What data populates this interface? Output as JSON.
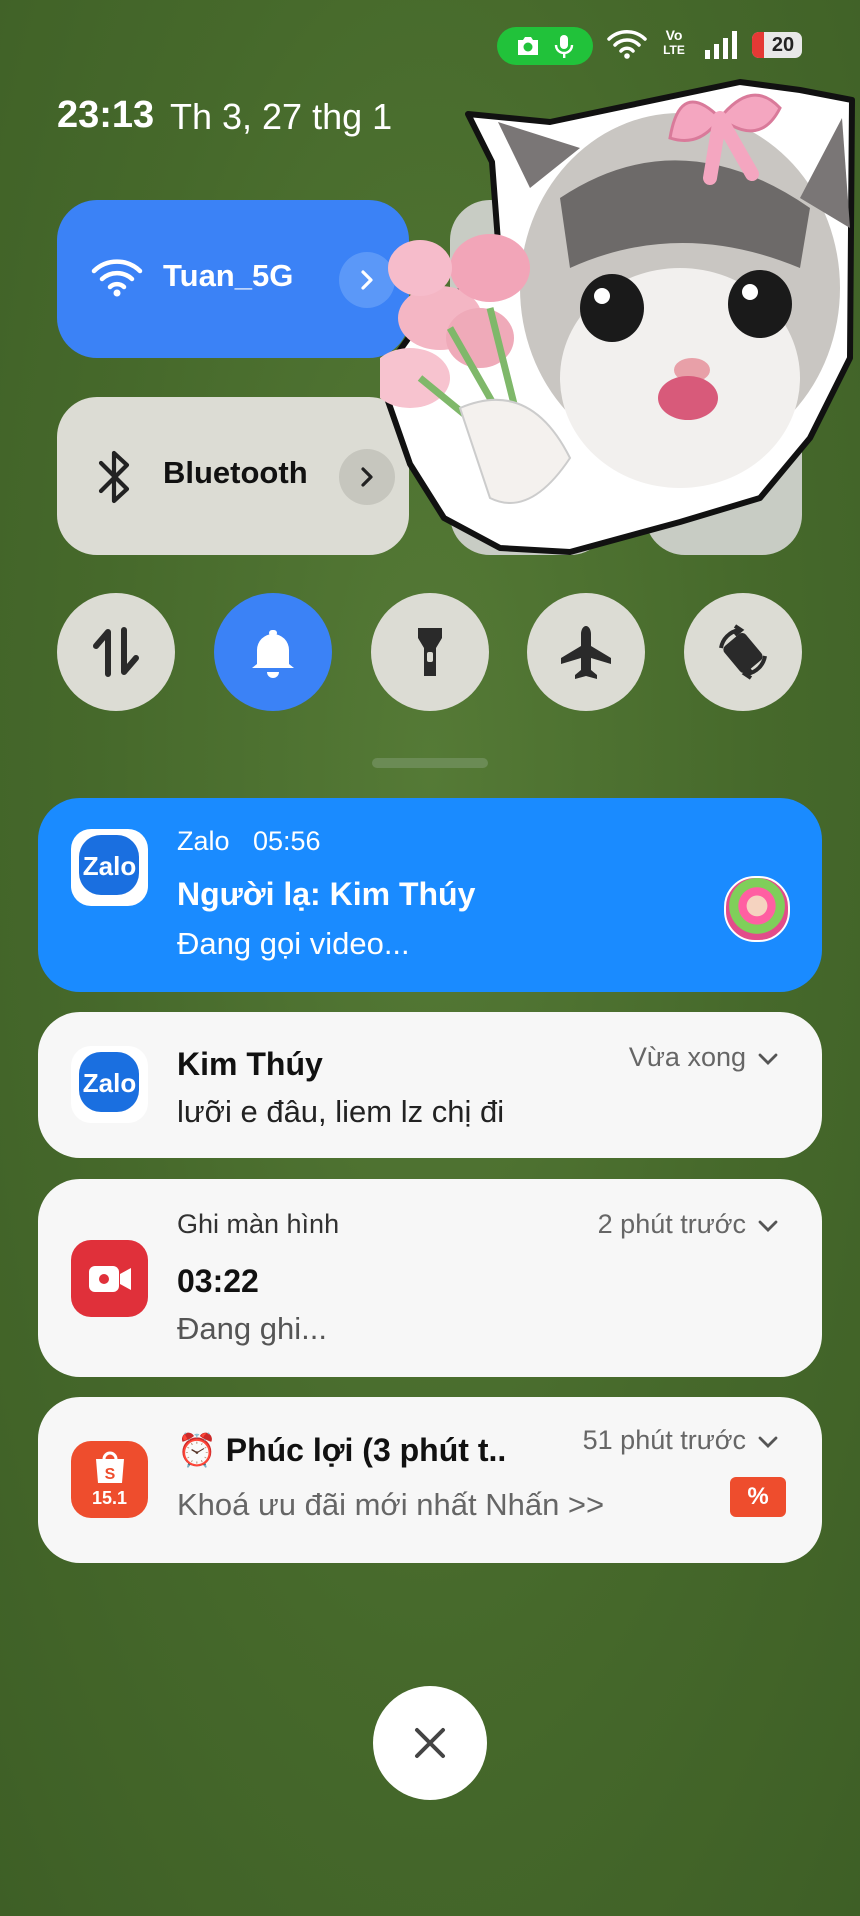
{
  "status_bar": {
    "battery": "20",
    "battery_level_percent": 20,
    "icons": [
      "camera-icon",
      "mic-icon",
      "wifi-icon",
      "volte-icon",
      "signal-icon",
      "battery-icon"
    ],
    "volte_top": "Vo",
    "volte_bottom": "LTE"
  },
  "header": {
    "time": "23:13",
    "date": "Th 3, 27 thg 1"
  },
  "quick_settings": {
    "wifi": {
      "label": "Tuan_5G",
      "icon": "wifi-icon",
      "active": true
    },
    "bluetooth": {
      "label": "Bluetooth",
      "icon": "bluetooth-icon",
      "active": false
    },
    "toggles": [
      {
        "name": "mobile-data",
        "icon": "data-arrows-icon",
        "active": false
      },
      {
        "name": "sound",
        "icon": "bell-icon",
        "active": true
      },
      {
        "name": "flashlight",
        "icon": "flashlight-icon",
        "active": false
      },
      {
        "name": "airplane-mode",
        "icon": "airplane-icon",
        "active": false
      },
      {
        "name": "auto-rotate",
        "icon": "rotate-icon",
        "active": false
      }
    ]
  },
  "notifications": [
    {
      "app": "Zalo",
      "time": "05:56",
      "title": "Người lạ: Kim Thúy",
      "body": "Đang gọi video...",
      "app_icon_text": "Zalo"
    },
    {
      "title": "Kim Thúy",
      "body": "lưỡi e đâu, liem lz chị đi",
      "meta": "Vừa xong",
      "app_icon_text": "Zalo"
    },
    {
      "app": "Ghi màn hình",
      "title": "03:22",
      "body": "Đang ghi...",
      "meta": "2 phút trước"
    },
    {
      "title": "⏰ Phúc lợi (3 phút t...",
      "body": "Khoá ưu đãi mới nhất Nhấn >>",
      "meta": "51 phút trước",
      "app_icon_text": "15.1",
      "badge": "%"
    }
  ],
  "colors": {
    "background": "#4a6e2e",
    "accent_blue": "#3b82f6",
    "notification_blue": "#1a8bff",
    "camera_pill": "#21c23a",
    "recorder_red": "#e0303a",
    "shopee_orange": "#ee4d2d"
  }
}
